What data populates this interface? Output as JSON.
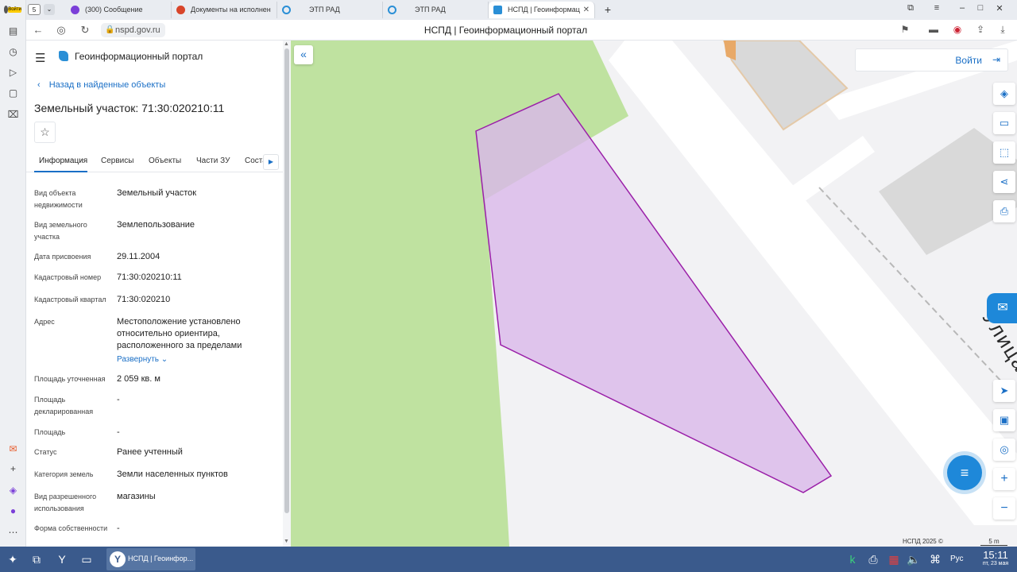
{
  "browser": {
    "profile_tag": "Войти",
    "tab_count": "5",
    "tabs": [
      {
        "title": "(300) Сообщение"
      },
      {
        "title": "Документы на исполнен"
      },
      {
        "title": "ЭТП РАД"
      },
      {
        "title": "ЭТП РАД"
      },
      {
        "title": "НСПД | Геоинформац"
      }
    ],
    "url": "nspd.gov.ru",
    "page_title": "НСПД | Геоинформационный портал",
    "colors": {
      "accent": "#1a6fc6",
      "tab_bar": "#e9ecf1"
    }
  },
  "panel": {
    "portal_name": "Геоинформационный портал",
    "back_link": "Назад в найденные объекты",
    "heading": "Земельный участок: 71:30:020210:11",
    "tabs": [
      "Информация",
      "Сервисы",
      "Объекты",
      "Части ЗУ",
      "Соста"
    ],
    "fields": [
      {
        "label": "Вид объекта недвижимости",
        "value": "Земельный участок"
      },
      {
        "label": "Вид земельного участка",
        "value": "Землепользование"
      },
      {
        "label": "Дата присвоения",
        "value": "29.11.2004"
      },
      {
        "label": "Кадастровый номер",
        "value": "71:30:020210:11"
      },
      {
        "label": "Кадастровый квартал",
        "value": "71:30:020210"
      },
      {
        "label": "Адрес",
        "value": "Местоположение установлено относительно ориентира, расположенного за пределами",
        "expand": "Развернуть"
      },
      {
        "label": "Площадь уточненная",
        "value": "2 059 кв. м"
      },
      {
        "label": "Площадь декларированная",
        "value": "-"
      },
      {
        "label": "Площадь",
        "value": "-"
      },
      {
        "label": "Статус",
        "value": "Ранее учтенный"
      },
      {
        "label": "Категория земель",
        "value": "Земли населенных пунктов"
      },
      {
        "label": "Вид разрешенного использования",
        "value": "магазины"
      },
      {
        "label": "Форма собственности",
        "value": "-"
      }
    ]
  },
  "map": {
    "street_label": "Улица Маршала Жукова",
    "login_label": "Войти",
    "copyright": "НСПД 2025 ©",
    "scale_label": "5 m",
    "parcel_color": "#d9b8ea",
    "parcel_border": "#9a1fa8",
    "green_color": "#bfe2a0"
  },
  "taskbar": {
    "app_label": "НСПД | Геоинфор...",
    "language": "Рус",
    "time": "15:11",
    "date": "пт, 23 мая"
  }
}
